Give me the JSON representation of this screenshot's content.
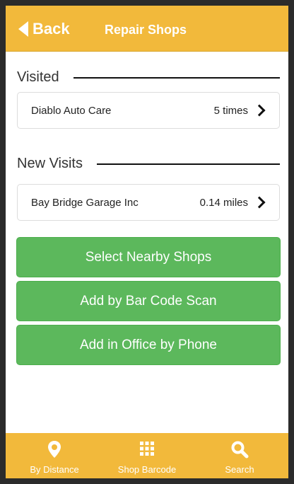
{
  "header": {
    "back_label": "Back",
    "title": "Repair Shops",
    "color": "#f2b93b"
  },
  "visited": {
    "title": "Visited",
    "items": [
      {
        "name": "Diablo Auto Care",
        "meta": "5 times"
      }
    ]
  },
  "new_visits": {
    "title": "New Visits",
    "items": [
      {
        "name": "Bay Bridge Garage Inc",
        "meta": "0.14 miles"
      }
    ]
  },
  "actions": {
    "select_nearby": "Select Nearby Shops",
    "add_bar_code": "Add by Bar Code Scan",
    "add_office_phone": "Add in Office by Phone",
    "color": "#5cb85c"
  },
  "tabbar": {
    "tabs": [
      {
        "label": "By Distance",
        "icon": "map-pin-icon"
      },
      {
        "label": "Shop Barcode",
        "icon": "grid-icon"
      },
      {
        "label": "Search",
        "icon": "search-icon"
      }
    ]
  }
}
